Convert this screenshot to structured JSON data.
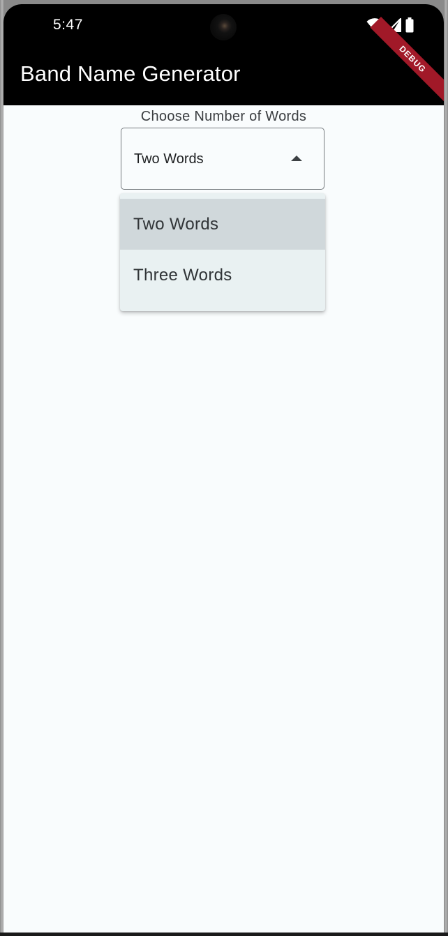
{
  "status_bar": {
    "time": "5:47",
    "icons": [
      "wifi-icon",
      "signal-icon",
      "battery-icon"
    ]
  },
  "app_bar": {
    "title": "Band Name Generator",
    "background": "#000000"
  },
  "debug_banner": {
    "label": "DEBUG",
    "color": "#a11928"
  },
  "form": {
    "label": "Choose Number of Words",
    "dropdown": {
      "selected": "Two Words",
      "expanded": true,
      "options": [
        "Two Words",
        "Three Words"
      ]
    }
  }
}
